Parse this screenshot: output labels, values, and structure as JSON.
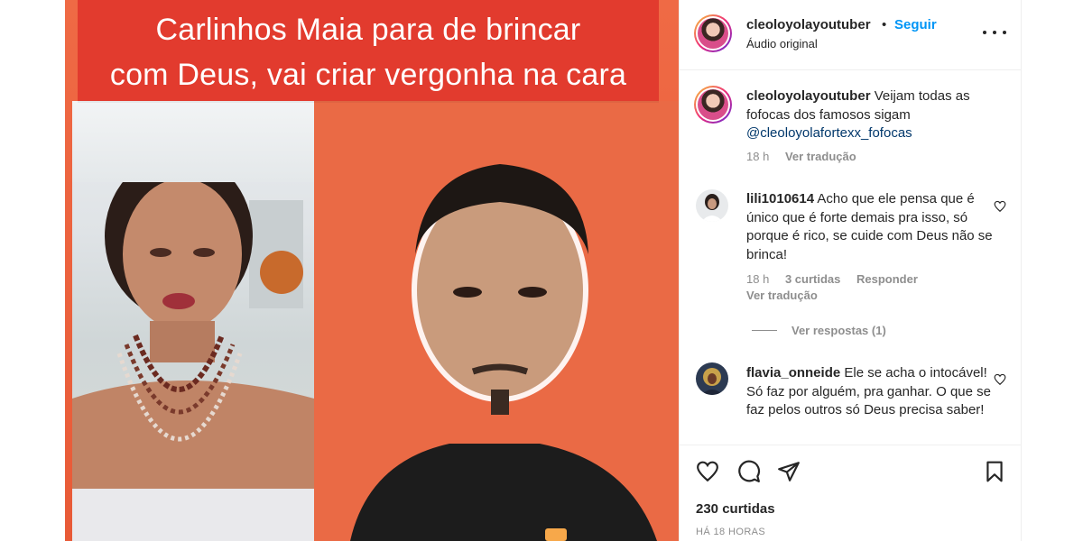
{
  "post": {
    "title_line1": "Carlinhos Maia para de brincar",
    "title_line2": "com Deus, vai criar vergonha na cara"
  },
  "header": {
    "username": "cleoloyolayoutuber",
    "separator": "•",
    "follow_label": "Seguir",
    "subtitle": "Áudio original"
  },
  "caption": {
    "username": "cleoloyolayoutuber",
    "text": "Veijam todas as fofocas dos famosos sigam",
    "mention": "@cleoloyolafortexx_fofocas",
    "time": "18 h",
    "translate": "Ver tradução"
  },
  "comments": [
    {
      "username": "lili1010614",
      "text": "Acho que ele pensa que é único que é forte demais pra isso, só porque é rico, se cuide com Deus não se brinca!",
      "time": "18 h",
      "likes": "3 curtidas",
      "reply": "Responder",
      "translate": "Ver tradução",
      "view_replies": "Ver respostas (1)"
    },
    {
      "username": "flavia_onneide",
      "text": "Ele se acha o intocável! Só faz por alguém, pra ganhar. O que se faz pelos outros só Deus precisa saber!"
    }
  ],
  "footer": {
    "likes": "230 curtidas",
    "time_ago": "HÁ 18 HORAS"
  },
  "icons": [
    "more-icon",
    "heart-icon",
    "comment-icon",
    "share-icon",
    "bookmark-icon"
  ],
  "colors": {
    "accent": "#0095f6",
    "banner": "#e23b2e",
    "background_orange": "#e8643f",
    "text": "#262626",
    "muted": "#8e8e8e",
    "mention": "#00376b"
  }
}
